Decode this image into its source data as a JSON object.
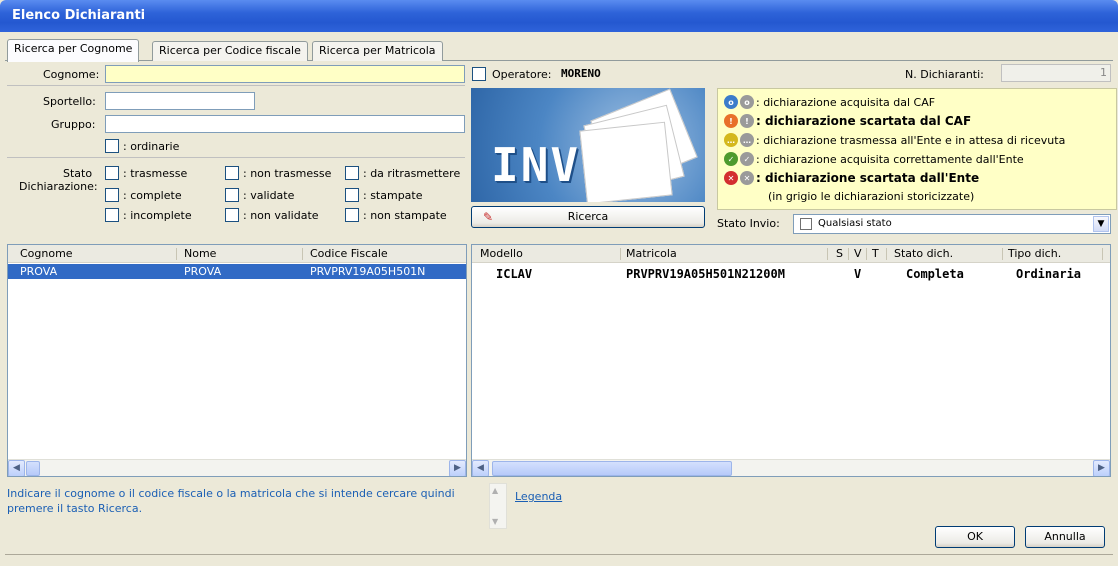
{
  "window": {
    "title": "Elenco Dichiaranti"
  },
  "tabs": [
    {
      "label": "Ricerca per Cognome"
    },
    {
      "label": "Ricerca per Codice fiscale"
    },
    {
      "label": "Ricerca per Matricola"
    }
  ],
  "search": {
    "cognome_label": "Cognome:",
    "cognome_value": "",
    "sportello_label": "Sportello:",
    "sportello_value": "",
    "gruppo_label": "Gruppo:",
    "gruppo_value": "",
    "ordinarie_label": ": ordinarie",
    "operatore_label": "Operatore:",
    "operatore_value": "MORENO",
    "n_dichiaranti_label": "N. Dichiaranti:",
    "n_dichiaranti_value": "1"
  },
  "stato": {
    "label_line1": "Stato",
    "label_line2": "Dichiarazione:",
    "options": [
      ": trasmesse",
      ": non trasmesse",
      ": da ritrasmettere",
      ": complete",
      ": validate",
      ": stampate",
      ": incomplete",
      ": non validate",
      ": non stampate"
    ]
  },
  "logo": {
    "text": "INV"
  },
  "ricerca_button": "Ricerca",
  "legend": {
    "rows": [
      {
        "text": ": dichiarazione acquisita dal CAF",
        "bold": false,
        "color": "#3D7DCA",
        "icon": "info-icon"
      },
      {
        "text": ": dichiarazione scartata dal CAF",
        "bold": true,
        "color": "#E8702A",
        "icon": "warning-icon"
      },
      {
        "text": ": dichiarazione trasmessa all'Ente e in attesa di ricevuta",
        "bold": false,
        "color": "#D4B81C",
        "icon": "pending-icon"
      },
      {
        "text": ": dichiarazione acquisita correttamente dall'Ente",
        "bold": false,
        "color": "#4E9A2E",
        "icon": "check-icon"
      },
      {
        "text": ": dichiarazione scartata dall'Ente",
        "bold": true,
        "color": "#D32F2F",
        "icon": "error-icon"
      }
    ],
    "note": "(in grigio le dichiarazioni storicizzate)"
  },
  "stato_invio": {
    "label": "Stato Invio:",
    "value": "Qualsiasi stato"
  },
  "left_table": {
    "headers": [
      "Cognome",
      "Nome",
      "Codice Fiscale"
    ],
    "rows": [
      [
        "PROVA",
        "PROVA",
        "PRVPRV19A05H501N"
      ]
    ]
  },
  "right_table": {
    "headers": [
      "Modello",
      "Matricola",
      "S",
      "V",
      "T",
      "Stato dich.",
      "Tipo dich."
    ],
    "rows": [
      [
        "ICLAV",
        "PRVPRV19A05H501N21200M",
        "",
        "V",
        "",
        "Completa",
        "Ordinaria"
      ]
    ]
  },
  "info_text": "Indicare il cognome o il codice fiscale o la matricola che si intende cercare quindi premere il tasto Ricerca.",
  "legenda_link": "Legenda",
  "buttons": {
    "ok": "OK",
    "annulla": "Annulla"
  },
  "colors": {
    "accent": "#316AC5",
    "hint": "#1B5FB4",
    "highlight": "#FFFFC6"
  }
}
